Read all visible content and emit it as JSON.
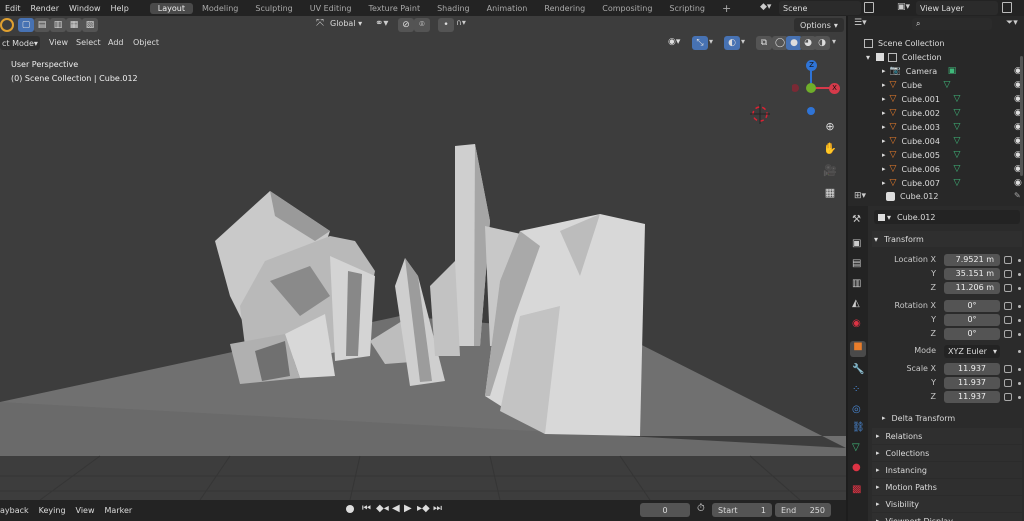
{
  "topbar": {
    "menus": [
      "Edit",
      "Render",
      "Window",
      "Help"
    ],
    "workspaces": [
      {
        "label": "Layout",
        "active": true
      },
      {
        "label": "Modeling"
      },
      {
        "label": "Sculpting"
      },
      {
        "label": "UV Editing"
      },
      {
        "label": "Texture Paint"
      },
      {
        "label": "Shading"
      },
      {
        "label": "Animation"
      },
      {
        "label": "Rendering"
      },
      {
        "label": "Compositing"
      },
      {
        "label": "Scripting"
      }
    ],
    "add_tab": "+",
    "scene": "Scene",
    "view_layer": "View Layer"
  },
  "viewport": {
    "header": {
      "orientation": "Global",
      "options": "Options"
    },
    "header2": {
      "mode": "ct Mode",
      "menus": [
        "View",
        "Select",
        "Add",
        "Object"
      ]
    },
    "overlay_text": {
      "perspective": "User Perspective",
      "collection": "(0) Scene Collection | Cube.012"
    },
    "gizmo": {
      "z": "Z",
      "x": "X"
    }
  },
  "timeline": {
    "menus": [
      "ayback",
      "Keying",
      "View",
      "Marker"
    ],
    "current_frame": "0",
    "start_label": "Start",
    "start_value": "1",
    "end_label": "End",
    "end_value": "250"
  },
  "outliner": {
    "root": "Scene Collection",
    "collection": "Collection",
    "items": [
      "Camera",
      "Cube",
      "Cube.001",
      "Cube.002",
      "Cube.003",
      "Cube.004",
      "Cube.005",
      "Cube.006",
      "Cube.007"
    ]
  },
  "properties": {
    "object_name": "Cube.012",
    "datablock_name": "Cube.012",
    "transform_title": "Transform",
    "location": {
      "label_x": "Location X",
      "label_y": "Y",
      "label_z": "Z",
      "x": "7.9521 m",
      "y": "35.151 m",
      "z": "11.206 m"
    },
    "rotation": {
      "label_x": "Rotation X",
      "label_y": "Y",
      "label_z": "Z",
      "x": "0°",
      "y": "0°",
      "z": "0°"
    },
    "mode_label": "Mode",
    "mode_value": "XYZ Euler",
    "scale": {
      "label_x": "Scale X",
      "label_y": "Y",
      "label_z": "Z",
      "x": "11.937",
      "y": "11.937",
      "z": "11.937"
    },
    "delta": "Delta Transform",
    "sections": [
      "Relations",
      "Collections",
      "Instancing",
      "Motion Paths",
      "Visibility",
      "Viewport Display"
    ]
  },
  "colors": {
    "accent": "#4772b3",
    "x_axis": "#d63a4a",
    "y_axis": "#6fae2a",
    "z_axis": "#2f74d6",
    "header": "#232323"
  }
}
